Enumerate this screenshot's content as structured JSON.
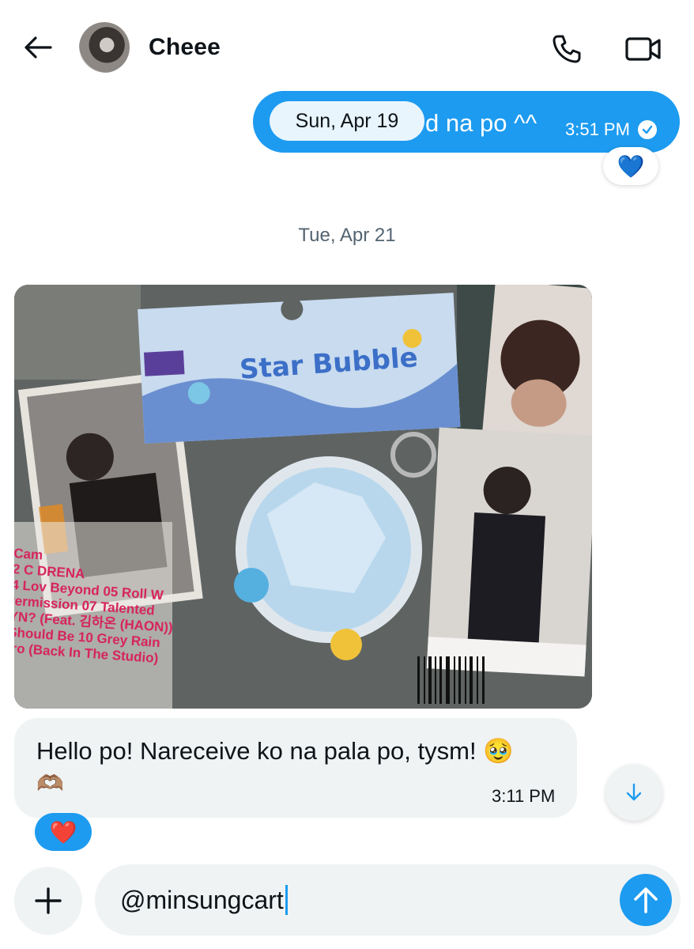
{
  "header": {
    "contact_name": "Cheee",
    "back_icon": "arrow-left-icon",
    "call_icon": "phone-icon",
    "video_icon": "video-camera-icon"
  },
  "messages": {
    "outgoing": {
      "text": "d na po ^^",
      "time": "3:51 PM",
      "date_badge": "Sun, Apr 19",
      "reaction": "💙"
    },
    "date_separator": "Tue, Apr 21",
    "photo": {
      "card_text": "Star Bubble",
      "tracklist_lines": [
        "Cam",
        "2 C  DRENA",
        "4 Lov  Beyond 05 Roll W",
        "termission 07 Talented",
        "YN? (Feat. 김하온 (HAON))",
        "Should Be 10 Grey Rain",
        "tro (Back In The Studio)"
      ]
    },
    "incoming": {
      "text": "Hello po! Nareceive ko na pala po, tysm! 🥹",
      "second_line": "🫶🏽",
      "time": "3:11 PM",
      "reaction": "❤️"
    }
  },
  "composer": {
    "value": "@minsungcart",
    "plus_icon": "plus-icon",
    "send_icon": "arrow-up-icon",
    "scroll_icon": "arrow-down-icon"
  },
  "colors": {
    "accent": "#1d9bf0",
    "bubble_incoming": "#eff3f4",
    "muted_text": "#536471"
  }
}
